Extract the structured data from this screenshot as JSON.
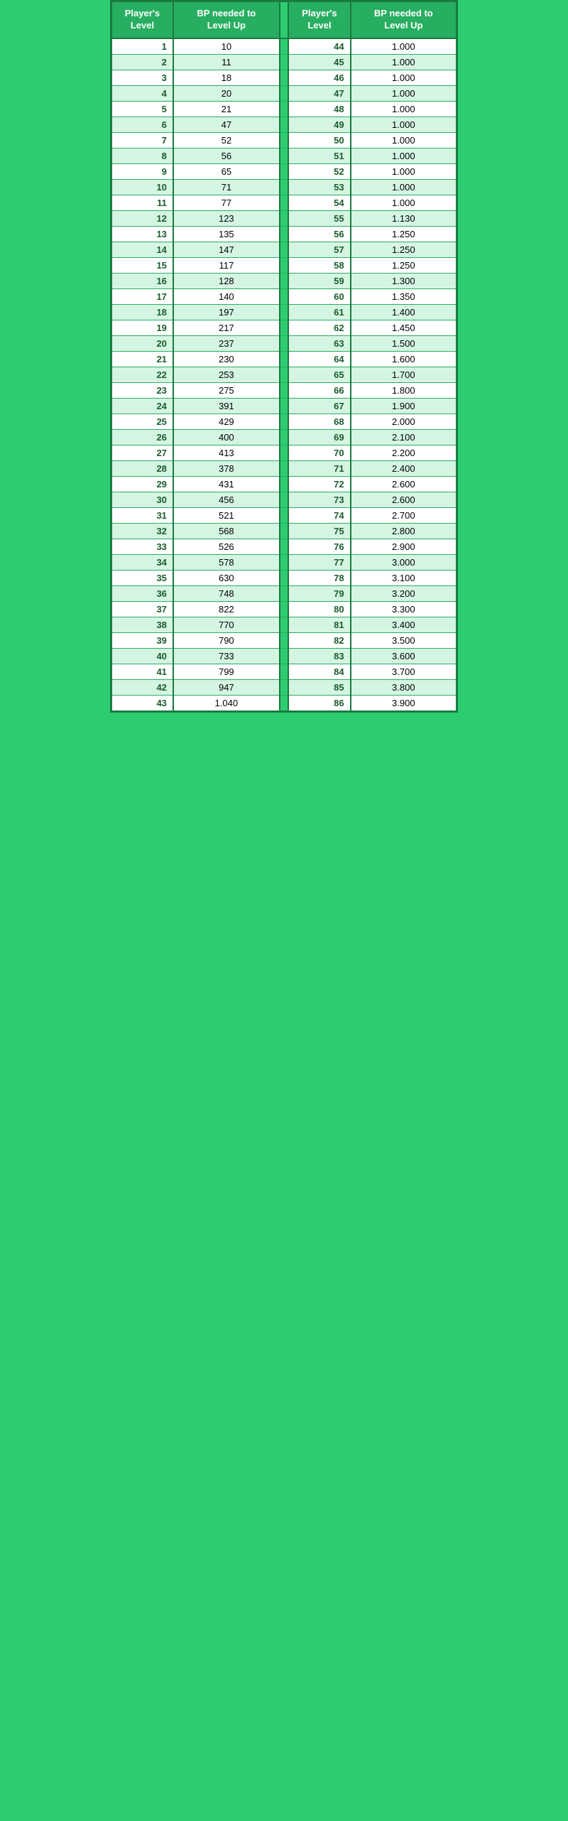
{
  "header": {
    "col1": "Player's\nLevel",
    "col2": "BP needed to\nLevel Up",
    "col3": "Player's\nLevel",
    "col4": "BP needed to\nLevel Up"
  },
  "rows": [
    [
      1,
      "10",
      44,
      "1.000"
    ],
    [
      2,
      "11",
      45,
      "1.000"
    ],
    [
      3,
      "18",
      46,
      "1.000"
    ],
    [
      4,
      "20",
      47,
      "1.000"
    ],
    [
      5,
      "21",
      48,
      "1.000"
    ],
    [
      6,
      "47",
      49,
      "1.000"
    ],
    [
      7,
      "52",
      50,
      "1.000"
    ],
    [
      8,
      "56",
      51,
      "1.000"
    ],
    [
      9,
      "65",
      52,
      "1.000"
    ],
    [
      10,
      "71",
      53,
      "1.000"
    ],
    [
      11,
      "77",
      54,
      "1.000"
    ],
    [
      12,
      "123",
      55,
      "1.130"
    ],
    [
      13,
      "135",
      56,
      "1.250"
    ],
    [
      14,
      "147",
      57,
      "1.250"
    ],
    [
      15,
      "117",
      58,
      "1.250"
    ],
    [
      16,
      "128",
      59,
      "1.300"
    ],
    [
      17,
      "140",
      60,
      "1.350"
    ],
    [
      18,
      "197",
      61,
      "1.400"
    ],
    [
      19,
      "217",
      62,
      "1.450"
    ],
    [
      20,
      "237",
      63,
      "1.500"
    ],
    [
      21,
      "230",
      64,
      "1.600"
    ],
    [
      22,
      "253",
      65,
      "1.700"
    ],
    [
      23,
      "275",
      66,
      "1.800"
    ],
    [
      24,
      "391",
      67,
      "1.900"
    ],
    [
      25,
      "429",
      68,
      "2.000"
    ],
    [
      26,
      "400",
      69,
      "2.100"
    ],
    [
      27,
      "413",
      70,
      "2.200"
    ],
    [
      28,
      "378",
      71,
      "2.400"
    ],
    [
      29,
      "431",
      72,
      "2.600"
    ],
    [
      30,
      "456",
      73,
      "2.600"
    ],
    [
      31,
      "521",
      74,
      "2.700"
    ],
    [
      32,
      "568",
      75,
      "2.800"
    ],
    [
      33,
      "526",
      76,
      "2.900"
    ],
    [
      34,
      "578",
      77,
      "3.000"
    ],
    [
      35,
      "630",
      78,
      "3.100"
    ],
    [
      36,
      "748",
      79,
      "3.200"
    ],
    [
      37,
      "822",
      80,
      "3.300"
    ],
    [
      38,
      "770",
      81,
      "3.400"
    ],
    [
      39,
      "790",
      82,
      "3.500"
    ],
    [
      40,
      "733",
      83,
      "3.600"
    ],
    [
      41,
      "799",
      84,
      "3.700"
    ],
    [
      42,
      "947",
      85,
      "3.800"
    ],
    [
      43,
      "1.040",
      86,
      "3.900"
    ]
  ]
}
